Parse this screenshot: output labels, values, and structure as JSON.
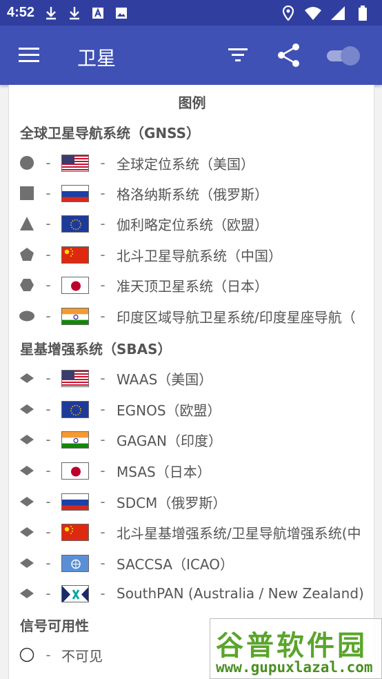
{
  "status_bar": {
    "time": "4:52",
    "left_icons": [
      "download-icon",
      "download-icon",
      "font-icon",
      "image-icon"
    ],
    "right_icons": [
      "location-icon",
      "wifi-icon",
      "signal-icon",
      "battery-icon"
    ]
  },
  "app_bar": {
    "title": "卫星",
    "color": "#3f51b5",
    "status_color": "#303f9f"
  },
  "legend": {
    "title": "图例",
    "gnss": {
      "section_title": "全球卫星导航系统（GNSS）",
      "items": [
        {
          "shape": "circle",
          "flag": "us",
          "label": "全球定位系统（美国）"
        },
        {
          "shape": "square",
          "flag": "ru",
          "label": "格洛纳斯系统（俄罗斯）"
        },
        {
          "shape": "triangle",
          "flag": "eu",
          "label": "伽利略定位系统（欧盟）"
        },
        {
          "shape": "pentagon",
          "flag": "cn",
          "label": "北斗卫星导航系统（中国）"
        },
        {
          "shape": "hexagon",
          "flag": "jp",
          "label": "准天顶卫星系统（日本）"
        },
        {
          "shape": "oval",
          "flag": "in",
          "label": "印度区域导航卫星系统/印度星座导航（"
        }
      ]
    },
    "sbas": {
      "section_title": "星基增强系统（SBAS）",
      "items": [
        {
          "shape": "diamond",
          "flag": "us",
          "label": "WAAS（美国）"
        },
        {
          "shape": "diamond",
          "flag": "eu",
          "label": "EGNOS（欧盟）"
        },
        {
          "shape": "diamond",
          "flag": "in",
          "label": "GAGAN（印度）"
        },
        {
          "shape": "diamond",
          "flag": "jp",
          "label": "MSAS（日本）"
        },
        {
          "shape": "diamond",
          "flag": "ru",
          "label": "SDCM（俄罗斯）"
        },
        {
          "shape": "diamond",
          "flag": "cn",
          "label": "北斗星基增强系统/卫星导航增强系统(中"
        },
        {
          "shape": "diamond",
          "flag": "icao",
          "label": "SACCSA（ICAO）"
        },
        {
          "shape": "diamond",
          "flag": "sp",
          "label": "SouthPAN (Australia / New Zealand)"
        }
      ]
    },
    "signal": {
      "section_title": "信号可用性",
      "items": [
        {
          "shape": "empty-circle",
          "label": "不可见"
        }
      ]
    }
  },
  "watermark": {
    "text_big": "谷普软件园",
    "text_small": "www.gupuxlazal.com"
  }
}
